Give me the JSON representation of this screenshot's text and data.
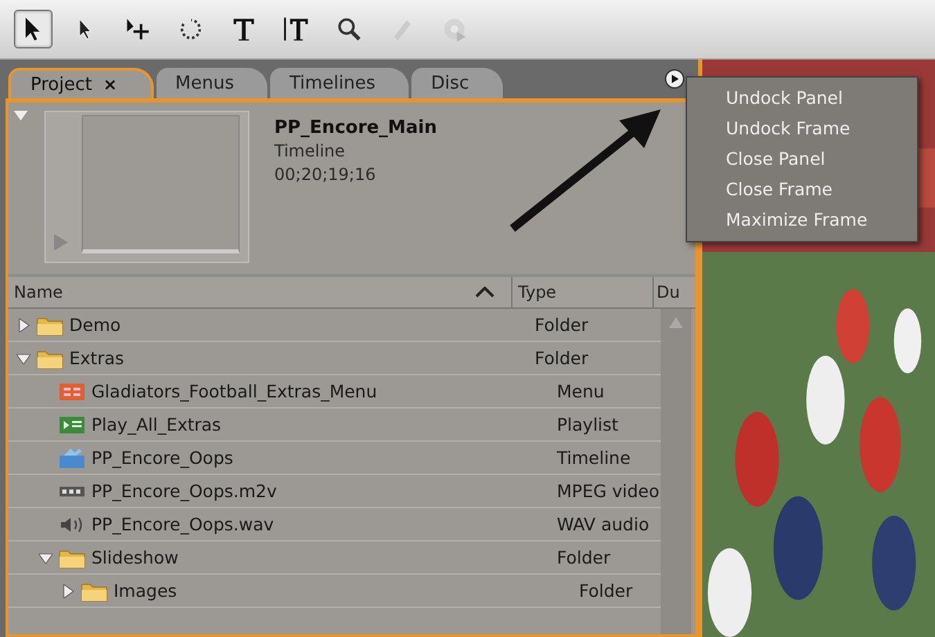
{
  "toolbar": {
    "tools": [
      {
        "kind": "select",
        "selected": true,
        "disabled": false
      },
      {
        "kind": "direct",
        "selected": false,
        "disabled": false
      },
      {
        "kind": "move",
        "selected": false,
        "disabled": false
      },
      {
        "kind": "rotate",
        "selected": false,
        "disabled": false
      },
      {
        "kind": "text",
        "selected": false,
        "disabled": false
      },
      {
        "kind": "vtext",
        "selected": false,
        "disabled": false
      },
      {
        "kind": "zoom",
        "selected": false,
        "disabled": false
      },
      {
        "kind": "pen",
        "selected": false,
        "disabled": true
      },
      {
        "kind": "disc",
        "selected": false,
        "disabled": true
      }
    ]
  },
  "tabs": [
    {
      "label": "Project",
      "close": "×",
      "selected": true
    },
    {
      "label": "Menus",
      "selected": false
    },
    {
      "label": "Timelines",
      "selected": false
    },
    {
      "label": "Disc",
      "selected": false
    }
  ],
  "preview": {
    "title": "PP_Encore_Main",
    "type": "Timeline",
    "duration": "00;20;19;16"
  },
  "table": {
    "columns": [
      "Name",
      "Type",
      "Du"
    ],
    "rows": [
      {
        "name": "Demo",
        "type": "Folder",
        "kind": "folder",
        "expanded": false
      },
      {
        "name": "Extras",
        "type": "Folder",
        "kind": "folder",
        "expanded": true,
        "children": [
          {
            "name": "Gladiators_Football_Extras_Menu",
            "type": "Menu",
            "kind": "menu"
          },
          {
            "name": "Play_All_Extras",
            "type": "Playlist",
            "kind": "playlist"
          },
          {
            "name": "PP_Encore_Oops",
            "type": "Timeline",
            "kind": "timeline"
          },
          {
            "name": "PP_Encore_Oops.m2v",
            "type": "MPEG video",
            "kind": "video"
          },
          {
            "name": "PP_Encore_Oops.wav",
            "type": "WAV audio",
            "kind": "audio"
          },
          {
            "name": "Slideshow",
            "type": "Folder",
            "kind": "folder",
            "expanded": true,
            "children": [
              {
                "name": "Images",
                "type": "Folder",
                "kind": "folder",
                "expanded": false
              }
            ]
          }
        ]
      }
    ]
  },
  "panel_menu": {
    "items": [
      "Undock Panel",
      "Undock Frame",
      "Close Panel",
      "Close Frame",
      "Maximize Frame"
    ]
  }
}
